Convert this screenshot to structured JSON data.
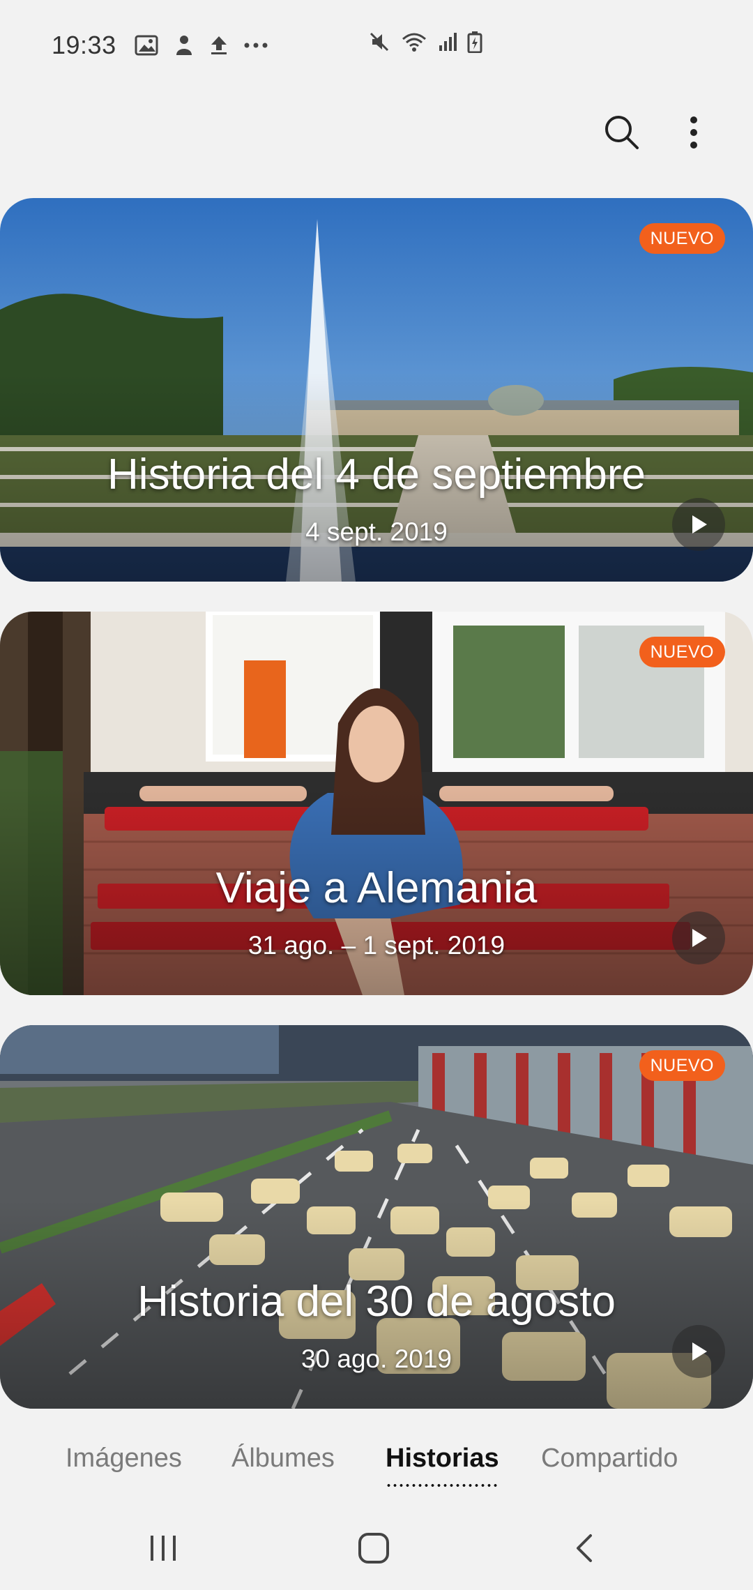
{
  "status_bar": {
    "time": "19:33",
    "left_icons": [
      "image-icon",
      "notification-icon",
      "upload-icon",
      "more-dots-icon"
    ],
    "right_icons": [
      "mute-icon",
      "wifi-icon",
      "signal-icon",
      "battery-icon"
    ]
  },
  "action_bar": {
    "search_icon": "search-icon",
    "more_icon": "more-vert-icon"
  },
  "stories": [
    {
      "title": "Historia del 4 de septiembre",
      "date": "4 sept. 2019",
      "badge": "NUEVO"
    },
    {
      "title": "Viaje a Alemania",
      "date": "31 ago. – 1 sept. 2019",
      "badge": "NUEVO"
    },
    {
      "title": "Historia del 30 de agosto",
      "date": "30 ago. 2019",
      "badge": "NUEVO"
    }
  ],
  "tabs": [
    {
      "label": "Imágenes",
      "active": false
    },
    {
      "label": "Álbumes",
      "active": false
    },
    {
      "label": "Historias",
      "active": true
    },
    {
      "label": "Compartido",
      "active": false
    }
  ],
  "colors": {
    "badge": "#f2601c",
    "background": "#f2f2f2",
    "active_tab": "#111111",
    "inactive_tab": "#7a7a7a"
  }
}
